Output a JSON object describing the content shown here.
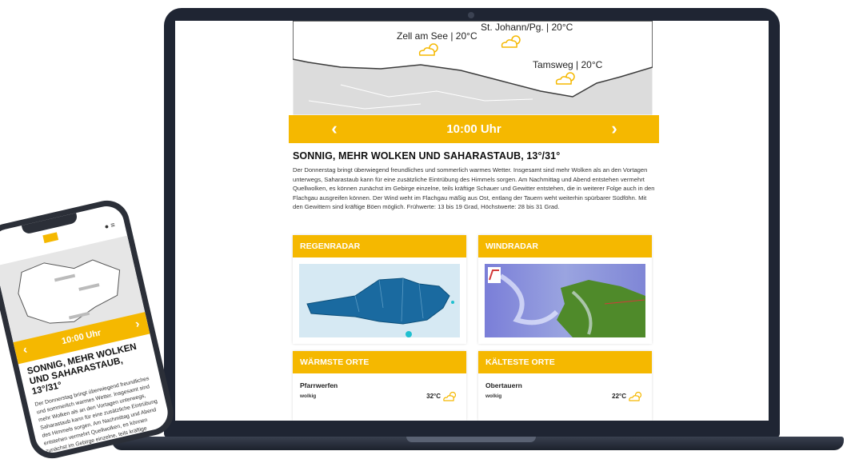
{
  "colors": {
    "accent": "#f5b800",
    "laptop": "#1f2533",
    "map_land": "#ffffff",
    "map_bg": "#ececec"
  },
  "map": {
    "cities": [
      {
        "label": "Zell am See | 20°C",
        "icon": "partly-cloudy-icon"
      },
      {
        "label": "St. Johann/Pg. | 20°C",
        "icon": "partly-cloudy-icon"
      },
      {
        "label": "Tamsweg | 20°C",
        "icon": "partly-cloudy-icon"
      }
    ]
  },
  "timebar": {
    "time": "10:00 Uhr",
    "prev_icon": "‹",
    "next_icon": "›"
  },
  "forecast": {
    "title": "SONNIG, MEHR WOLKEN UND SAHARASTAUB, 13°/31°",
    "text": "Der Donnerstag bringt überwiegend freundliches und sommerlich warmes Wetter. Insgesamt sind mehr Wolken als an den Vortagen unterwegs, Saharastaub kann für eine zusätzliche Eintrübung des Himmels sorgen. Am Nachmittag und Abend entstehen vermehrt Quellwolken, es können zunächst im Gebirge einzelne, teils kräftige Schauer und Gewitter entstehen, die in weiterer Folge auch in den Flachgau ausgreifen können. Der Wind weht im Flachgau mäßig aus Ost, entlang der Tauern weht weiterhin spürbarer Südföhn. Mit den Gewittern sind kräftige Böen möglich. Frühwerte: 13 bis 19 Grad, Höchstwerte: 28 bis 31 Grad."
  },
  "cards": {
    "regenradar": {
      "title": "REGENRADAR"
    },
    "windradar": {
      "title": "WINDRADAR"
    },
    "warmste": {
      "title": "WÄRMSTE ORTE",
      "place": "Pfarrwerfen",
      "condition": "wolkig",
      "temp": "32°C"
    },
    "kalteste": {
      "title": "KÄLTESTE ORTE",
      "place": "Obertauern",
      "condition": "wolkig",
      "temp": "22°C"
    }
  },
  "phone": {
    "time": "10:00 Uhr",
    "title": "SONNIG, MEHR WOLKEN UND SAHARASTAUB, 13°/31°",
    "text": "Der Donnerstag bringt überwiegend freundliches und sommerlich warmes Wetter. Insgesamt sind mehr Wolken als an den Vortagen unterwegs, Saharastaub kann für eine zusätzliche Eintrübung des Himmels sorgen. Am Nachmittag und Abend entstehen vermehrt Quellwolken, es können zunächst im Gebirge einzelne, teils kräftige Schauer und Gewitter entstehen"
  }
}
